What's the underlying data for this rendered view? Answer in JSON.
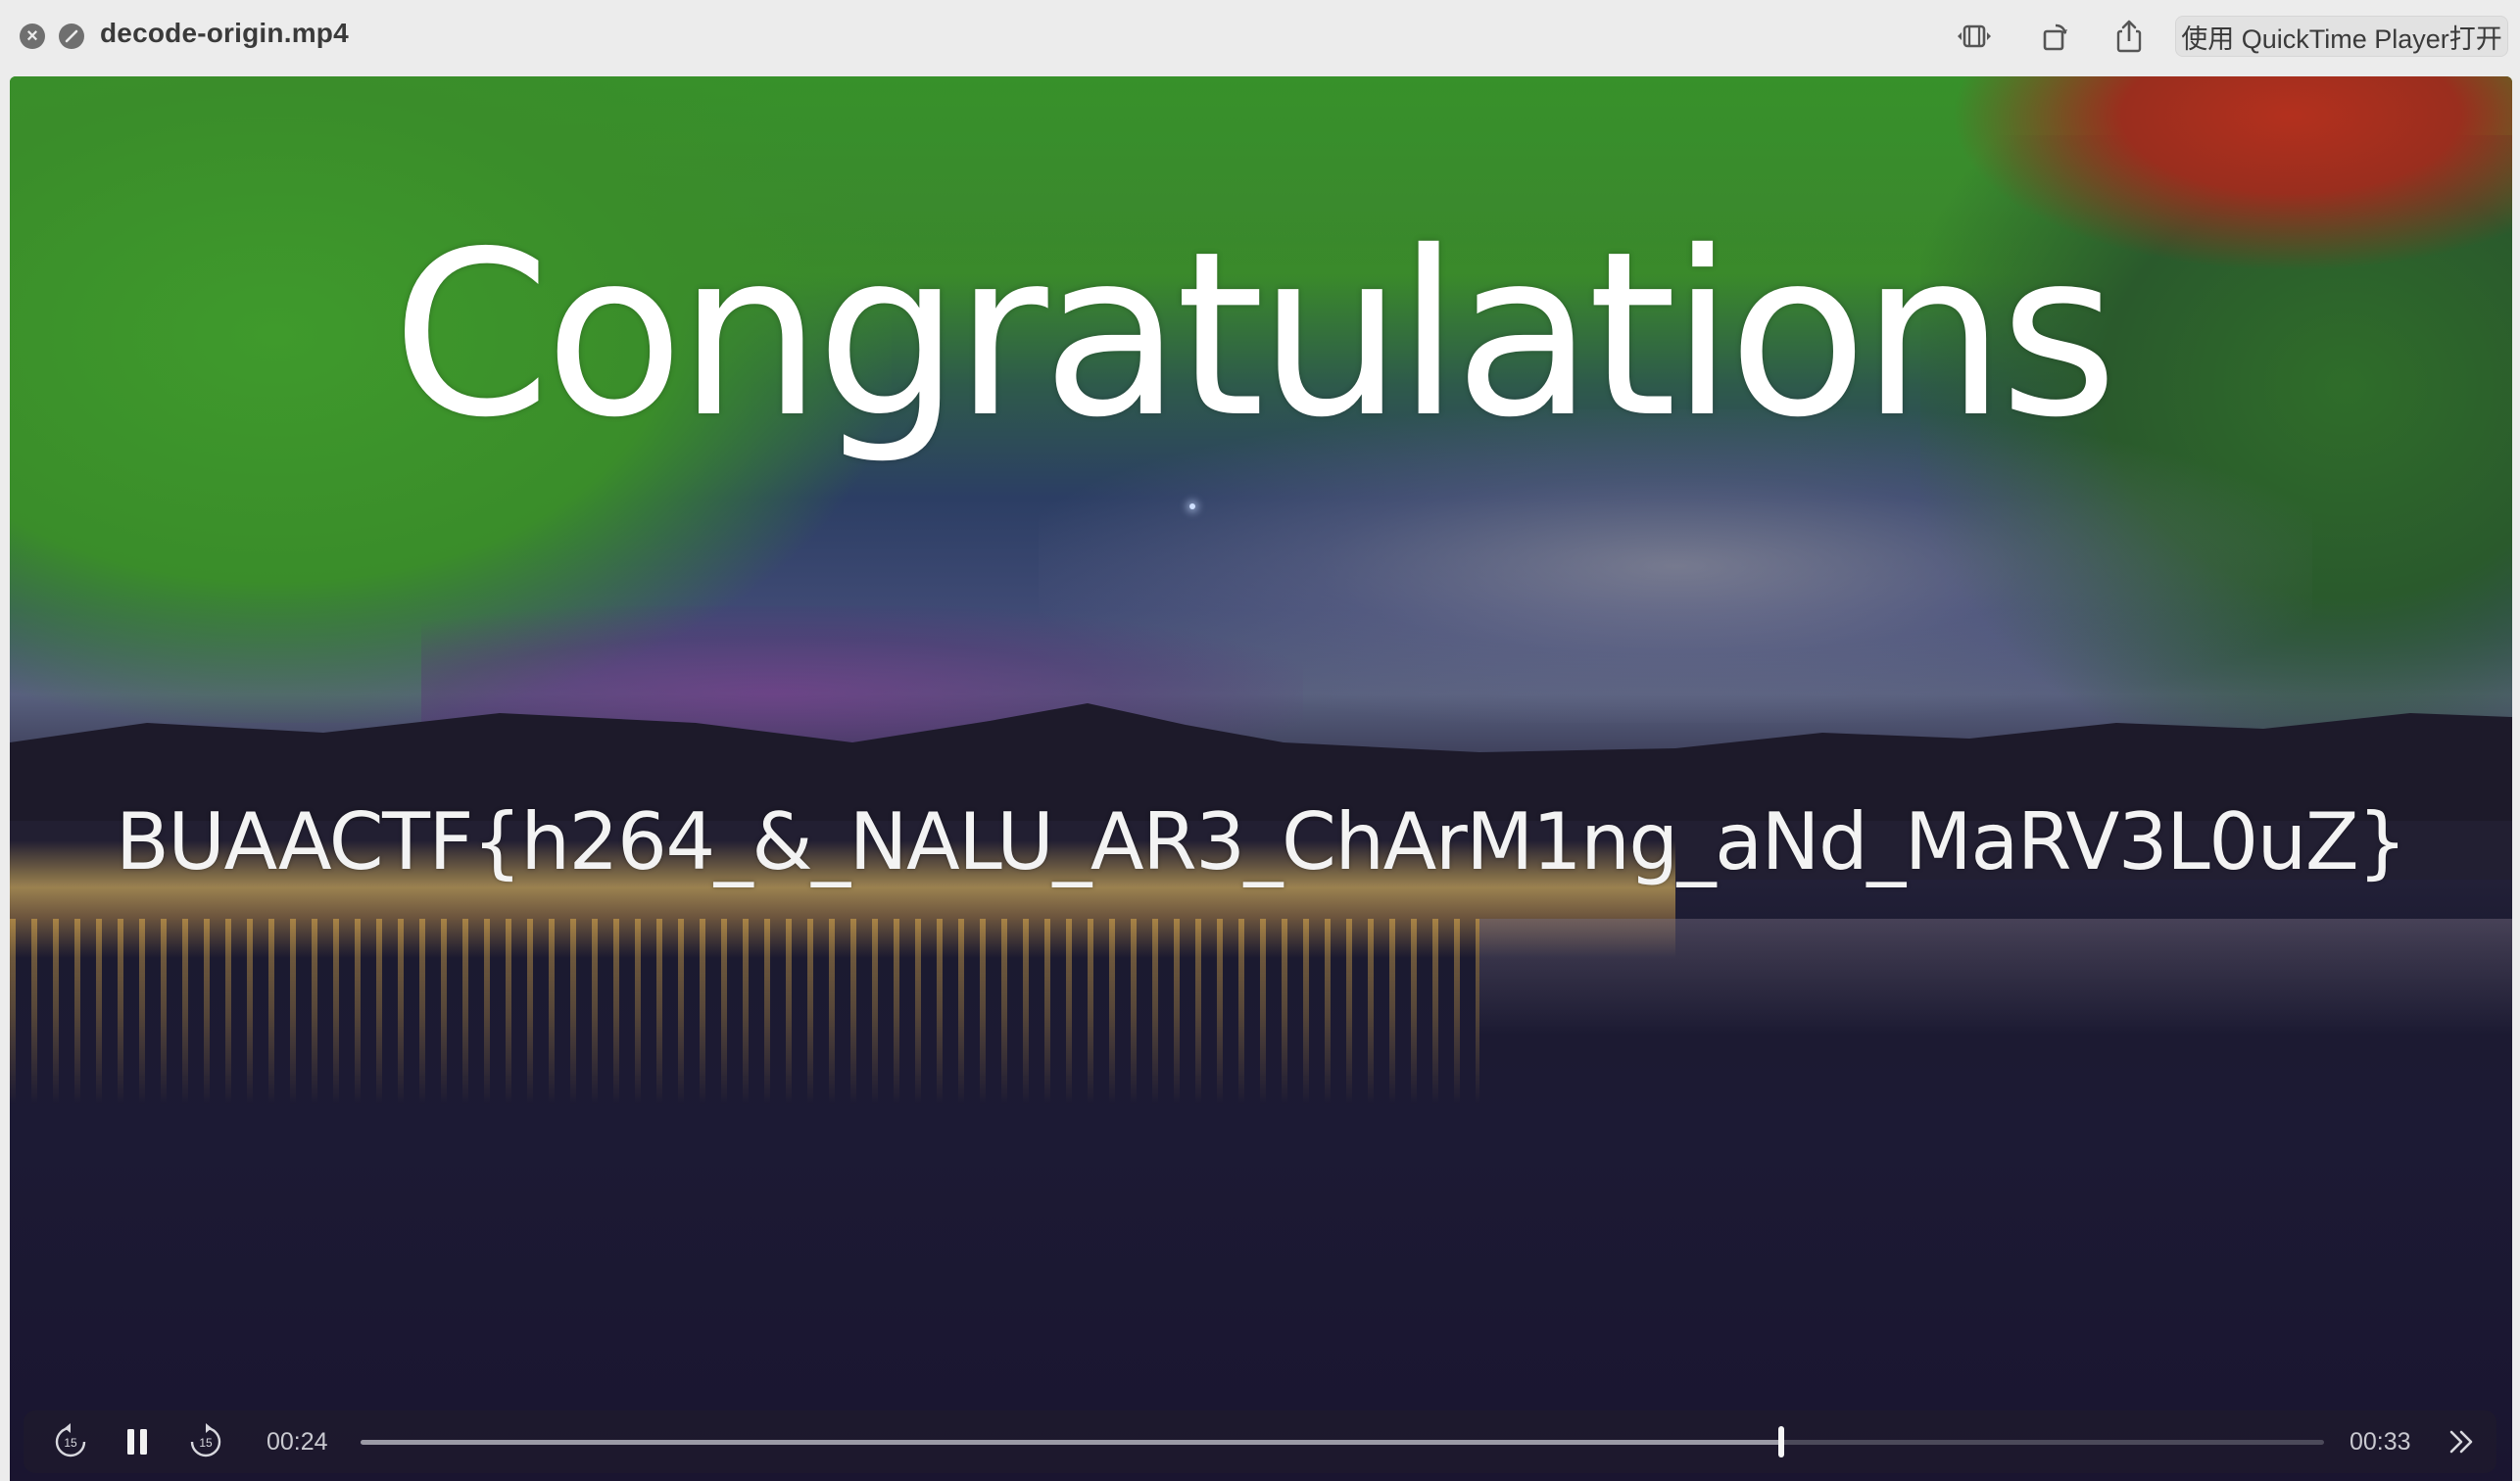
{
  "window": {
    "title": "decode-origin.mp4",
    "open_with_button": "使用 QuickTime Player打开"
  },
  "titlebar_icons": {
    "close": "close-icon",
    "stop": "stop-icon",
    "trim": "trim-icon",
    "rotate": "rotate-icon",
    "share": "share-icon"
  },
  "video": {
    "title_text": "Congratulations",
    "flag_text": "BUAACTF{h264_&_NALU_AR3_ChArM1ng_aNd_MaRV3L0uZ}"
  },
  "playback": {
    "current_time": "00:24",
    "duration": "00:33",
    "progress_fraction": 0.7238,
    "skip_back_seconds": "15",
    "skip_forward_seconds": "15",
    "state": "playing"
  },
  "colors": {
    "titlebar_bg": "#ececec",
    "controls_bg": "#1e1a2c",
    "text_white": "#ffffff"
  }
}
